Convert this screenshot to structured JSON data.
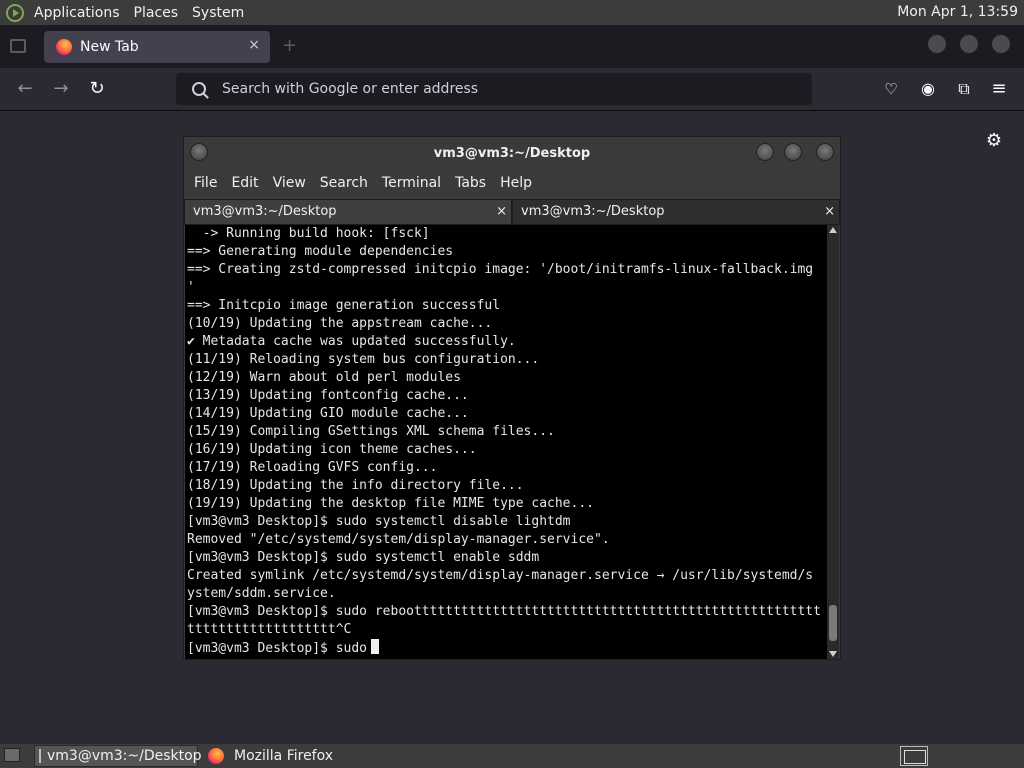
{
  "top_panel": {
    "menus": [
      "Applications",
      "Places",
      "System"
    ],
    "clock": "Mon Apr 1, 13:59"
  },
  "firefox": {
    "tab_title": "New Tab",
    "tab_close": "×",
    "url_placeholder": "Search with Google or enter address",
    "icons": [
      "back-icon",
      "forward-icon",
      "reload-icon",
      "pocket-icon",
      "account-icon",
      "extensions-icon",
      "menu-icon",
      "settings-gear-icon"
    ]
  },
  "terminal": {
    "title": "vm3@vm3:~/Desktop",
    "menus": [
      "File",
      "Edit",
      "View",
      "Search",
      "Terminal",
      "Tabs",
      "Help"
    ],
    "tabs": [
      {
        "label": "vm3@vm3:~/Desktop",
        "close": "×"
      },
      {
        "label": "vm3@vm3:~/Desktop",
        "close": "×"
      }
    ],
    "lines": [
      "  -> Running build hook: [fsck]",
      "==> Generating module dependencies",
      "==> Creating zstd-compressed initcpio image: '/boot/initramfs-linux-fallback.img",
      "'",
      "==> Initcpio image generation successful",
      "(10/19) Updating the appstream cache...",
      "✔ Metadata cache was updated successfully.",
      "(11/19) Reloading system bus configuration...",
      "(12/19) Warn about old perl modules",
      "(13/19) Updating fontconfig cache...",
      "(14/19) Updating GIO module cache...",
      "(15/19) Compiling GSettings XML schema files...",
      "(16/19) Updating icon theme caches...",
      "(17/19) Reloading GVFS config...",
      "(18/19) Updating the info directory file...",
      "(19/19) Updating the desktop file MIME type cache...",
      "[vm3@vm3 Desktop]$ sudo systemctl disable lightdm",
      "Removed \"/etc/systemd/system/display-manager.service\".",
      "[vm3@vm3 Desktop]$ sudo systemctl enable sddm",
      "Created symlink /etc/systemd/system/display-manager.service → /usr/lib/systemd/s",
      "ystem/sddm.service.",
      "[vm3@vm3 Desktop]$ sudo rebootttttttttttttttttttttttttttttttttttttttttttttttttttt",
      "ttttttttttttttttttt^C"
    ],
    "prompt": "[vm3@vm3 Desktop]$ sudo"
  },
  "taskbar": {
    "items": [
      "vm3@vm3:~/Desktop",
      "Mozilla Firefox"
    ]
  }
}
